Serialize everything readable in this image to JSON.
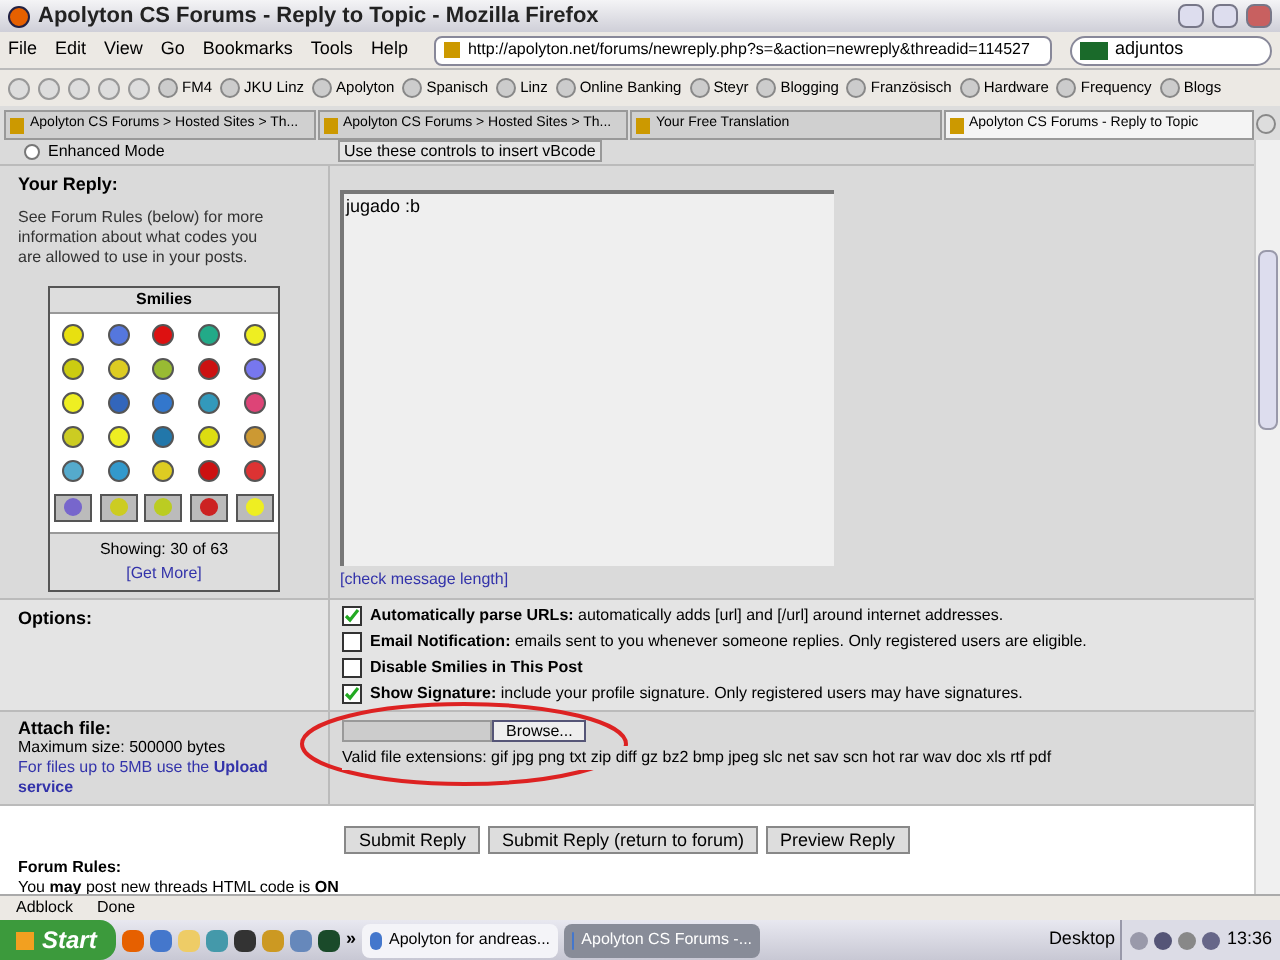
{
  "window": {
    "title": "Apolyton CS Forums - Reply to Topic - Mozilla Firefox"
  },
  "menu": [
    "File",
    "Edit",
    "View",
    "Go",
    "Bookmarks",
    "Tools",
    "Help"
  ],
  "address": {
    "value": "http://apolyton.net/forums/newreply.php?s=&action=newreply&threadid=114527"
  },
  "search": {
    "value": "adjuntos"
  },
  "bookmarks": [
    "FM4",
    "JKU Linz",
    "Apolyton",
    "Spanisch",
    "Linz",
    "Online Banking",
    "Steyr",
    "Blogging",
    "Französisch",
    "Hardware",
    "Frequency",
    "Blogs"
  ],
  "tabs": [
    {
      "label": "Apolyton CS Forums > Hosted Sites > Th...",
      "selected": false
    },
    {
      "label": "Apolyton CS Forums > Hosted Sites > Th...",
      "selected": false
    },
    {
      "label": "Your Free Translation",
      "selected": false
    },
    {
      "label": "Apolyton CS Forums - Reply to Topic",
      "selected": true
    }
  ],
  "top_row": {
    "label": "Enhanced Mode",
    "selected": false,
    "hint": "Use these controls to insert vBcode"
  },
  "reply": {
    "heading": "Your Reply:",
    "help": "See Forum Rules (below) for more information about what codes you are allowed to use in your posts.",
    "smilies_title": "Smilies",
    "showing": "Showing: 30 of 63",
    "get_more": "[Get More]",
    "message": "jugado :b",
    "check_length": "[check message length]"
  },
  "options": {
    "heading": "Options:",
    "items": [
      {
        "label": "Automatically parse URLs:",
        "text": "automatically adds [url] and [/url] around internet addresses.",
        "checked": true
      },
      {
        "label": "Email Notification:",
        "text": "emails sent to you whenever someone replies. Only registered users are eligible.",
        "checked": false
      },
      {
        "label": "Disable Smilies in This Post",
        "checked": false
      },
      {
        "label": "Show Signature:",
        "text": "include your profile signature. Only registered users may have signatures.",
        "checked": true
      }
    ]
  },
  "attach": {
    "heading": "Attach file:",
    "max_size": "Maximum size: 500000 bytes",
    "upload_note": "For files up to 5MB use the **Upload service**",
    "browse": "Browse...",
    "extensions": "Valid file extensions: gif jpg png txt zip diff gz bz2 bmp jpeg slc net sav scn hot rar wav doc xls rtf pdf"
  },
  "buttons": [
    "Submit Reply",
    "Submit Reply (return to forum)",
    "Preview Reply"
  ],
  "forum_rules": {
    "heading": "Forum Rules:",
    "text": "You **may** post new threads HTML code is **ON**"
  },
  "status_bar": {
    "adblock": "Adblock",
    "status": "Done"
  },
  "taskbar": {
    "start": "Start",
    "windows": [
      {
        "label": "Apolyton for andreas...",
        "selected": false
      },
      {
        "label": "Apolyton CS Forums -...",
        "selected": true
      }
    ],
    "desktop": "Desktop",
    "more": "»",
    "time": "13:36"
  }
}
